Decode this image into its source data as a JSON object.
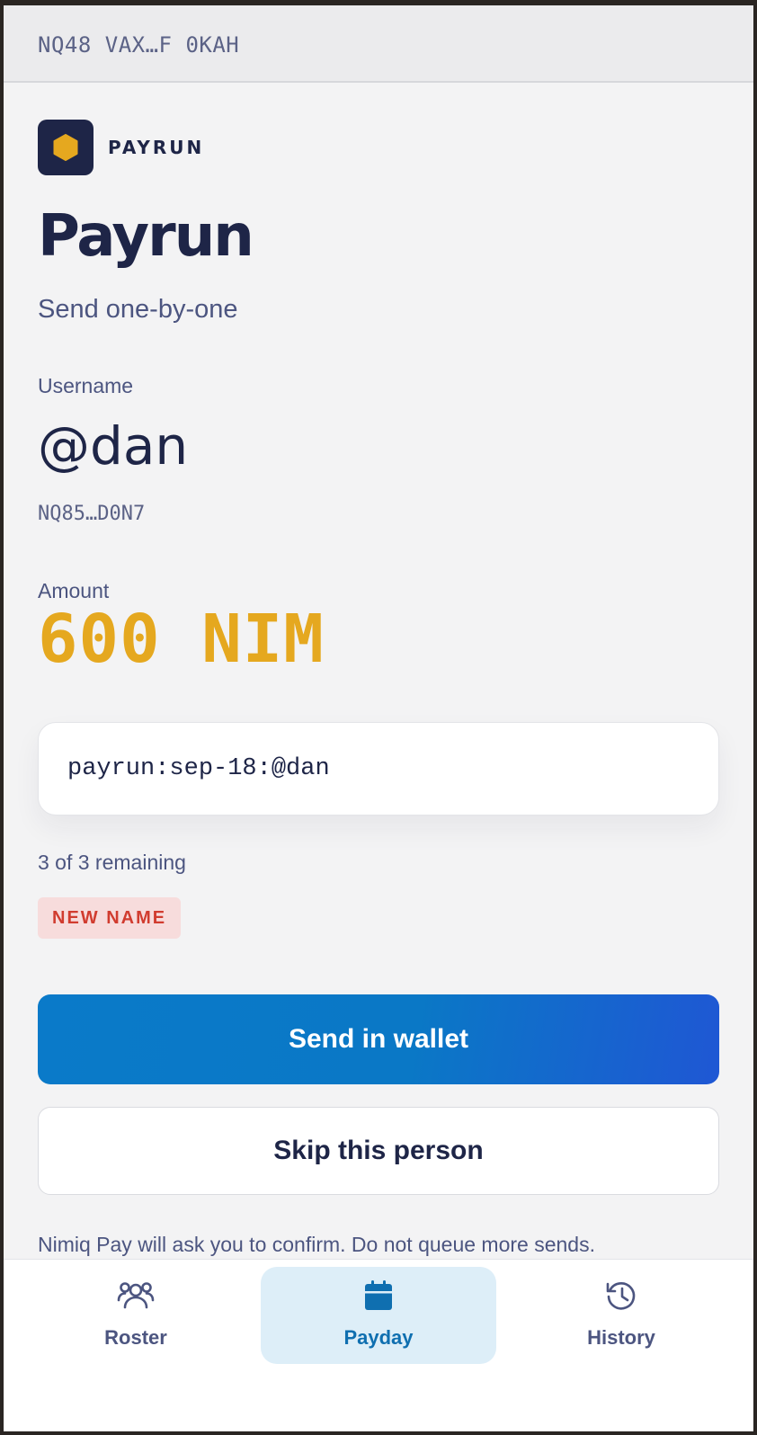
{
  "header": {
    "address": "NQ48 VAX…F 0KAH"
  },
  "brand": {
    "name": "PAYRUN",
    "logo_icon": "hexagon-icon",
    "logo_bg": "#1e2547",
    "logo_accent": "#e5a81f"
  },
  "page": {
    "title": "Payrun",
    "subtitle": "Send one-by-one"
  },
  "recipient": {
    "username_label": "Username",
    "username": "@dan",
    "address": "NQ85…D0N7",
    "amount_label": "Amount",
    "amount": "600 NIM"
  },
  "memo": {
    "value": "payrun:sep-18:@dan"
  },
  "progress": {
    "text": "3 of 3 remaining"
  },
  "badge": {
    "label": "NEW NAME"
  },
  "actions": {
    "send_label": "Send in wallet",
    "skip_label": "Skip this person",
    "note": "Nimiq Pay will ask you to confirm. Do not queue more sends."
  },
  "tabs": [
    {
      "label": "Roster",
      "icon": "users-icon",
      "active": false
    },
    {
      "label": "Payday",
      "icon": "calendar-icon",
      "active": true
    },
    {
      "label": "History",
      "icon": "history-icon",
      "active": false
    }
  ],
  "colors": {
    "accent": "#0a7ac9",
    "amount": "#e5a81f",
    "badge_text": "#d13c2f",
    "badge_bg": "#f7dcdc"
  }
}
